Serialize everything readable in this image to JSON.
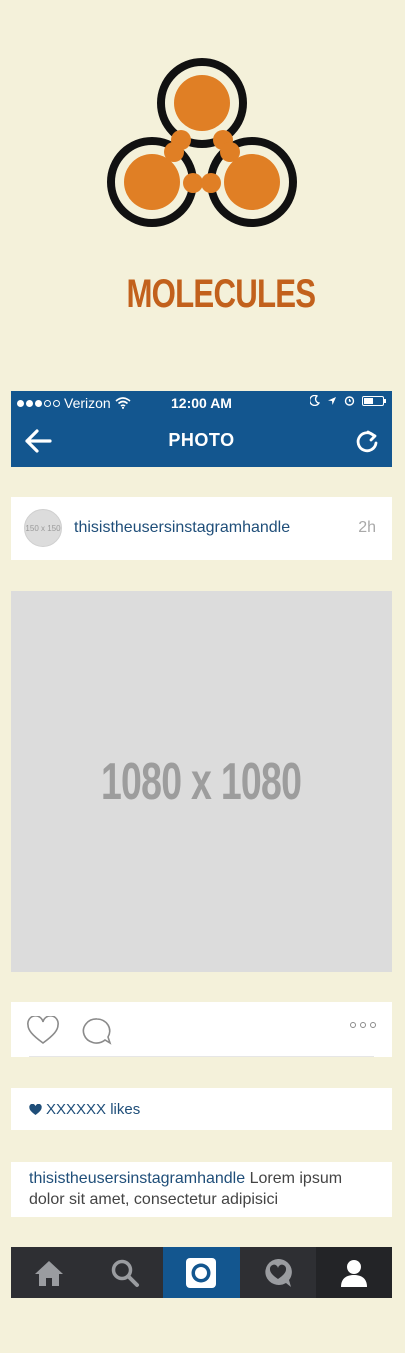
{
  "logo": {
    "text": "MOLECULES",
    "icon": "molecules-logo-icon"
  },
  "status_bar": {
    "carrier": "Verizon",
    "time": "12:00 AM"
  },
  "nav": {
    "title": "PHOTO"
  },
  "post": {
    "avatar_label": "150 x 150",
    "handle": "thisistheusersinstagramhandle",
    "time_ago": "2h",
    "photo_label": "1080 x 1080",
    "likes": "XXXXXX likes",
    "caption_handle": "thisistheusersinstagramhandle",
    "caption_text": " Lorem ipsum dolor sit amet, consectetur adipisici"
  },
  "tabs": [
    {
      "name": "home",
      "icon": "home-icon"
    },
    {
      "name": "search",
      "icon": "search-icon"
    },
    {
      "name": "camera",
      "icon": "camera-icon"
    },
    {
      "name": "activity",
      "icon": "activity-icon"
    },
    {
      "name": "profile",
      "icon": "profile-icon"
    }
  ],
  "colors": {
    "background": "#f4f1da",
    "brand_blue": "#13568f",
    "logo_orange": "#e07f25",
    "tab_bar": "#2e2f33"
  }
}
